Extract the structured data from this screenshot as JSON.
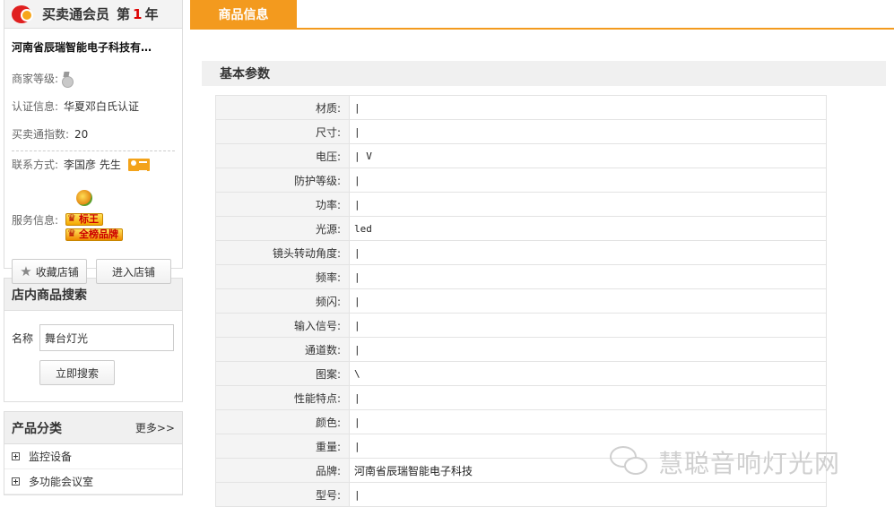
{
  "member": {
    "label": "买卖通会员",
    "year_prefix": "第",
    "year": "1",
    "year_suffix": "年"
  },
  "shop": {
    "name": "河南省辰瑞智能电子科技有…",
    "level_label": "商家等级:",
    "cert_label": "认证信息:",
    "cert_value": "华夏邓白氏认证",
    "index_label": "买卖通指数:",
    "index_value": "20",
    "contact_label": "联系方式:",
    "contact_value": "李国彦 先生",
    "service_label": "服务信息:",
    "badges": [
      "标王",
      "全榜品牌"
    ],
    "fav_button": "收藏店铺",
    "enter_button": "进入店铺"
  },
  "search": {
    "title": "店内商品搜索",
    "name_label": "名称",
    "input_value": "舞台灯光",
    "button": "立即搜索"
  },
  "categories": {
    "title": "产品分类",
    "more": "更多>>",
    "items": [
      "监控设备",
      "多功能会议室"
    ]
  },
  "tab": {
    "label": "商品信息"
  },
  "section": {
    "title": "基本参数"
  },
  "params": [
    {
      "k": "材质:",
      "v": "|"
    },
    {
      "k": "尺寸:",
      "v": "|"
    },
    {
      "k": "电压:",
      "v": "| V"
    },
    {
      "k": "防护等级:",
      "v": "|"
    },
    {
      "k": "功率:",
      "v": "|"
    },
    {
      "k": "光源:",
      "v": "led"
    },
    {
      "k": "镜头转动角度:",
      "v": "|"
    },
    {
      "k": "频率:",
      "v": "|"
    },
    {
      "k": "频闪:",
      "v": "|"
    },
    {
      "k": "输入信号:",
      "v": "|"
    },
    {
      "k": "通道数:",
      "v": "|"
    },
    {
      "k": "图案:",
      "v": "\\"
    },
    {
      "k": "性能特点:",
      "v": "|"
    },
    {
      "k": "颜色:",
      "v": "|"
    },
    {
      "k": "重量:",
      "v": "|"
    },
    {
      "k": "品牌:",
      "v": "河南省辰瑞智能电子科技"
    },
    {
      "k": "型号:",
      "v": "|"
    }
  ],
  "watermark": {
    "text": "慧聪音响灯光网"
  },
  "colors": {
    "accent": "#f39a1e",
    "badge_text": "#cc0000"
  }
}
